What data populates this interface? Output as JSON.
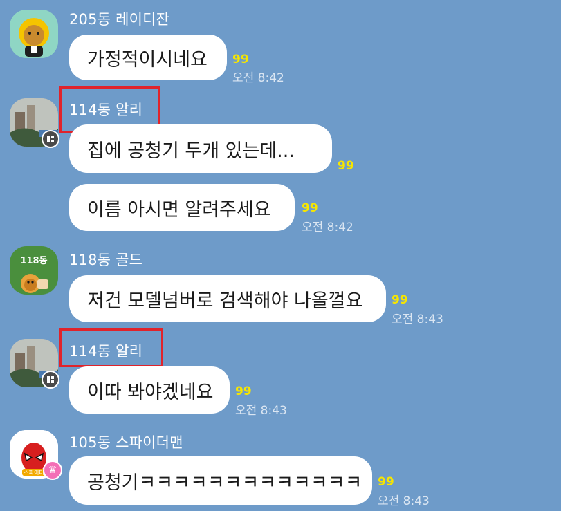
{
  "messages": [
    {
      "sender": "205동 레이디잔",
      "text": "가정적이시네요",
      "unread": "99",
      "time": "오전 8:42"
    },
    {
      "sender": "114동 알리",
      "text": "집에 공청기 두개 있는데...",
      "unread": "99",
      "time": ""
    },
    {
      "sender": "",
      "text": "이름  아시면 알려주세요",
      "unread": "99",
      "time": "오전 8:42"
    },
    {
      "sender": "118동 골드",
      "text": "저건 모델넘버로 검색해야 나올껄요",
      "unread": "99",
      "time": "오전 8:43",
      "avatar_label": "118동"
    },
    {
      "sender": "114동 알리",
      "text": "이따 봐야겠네요",
      "unread": "99",
      "time": "오전 8:43"
    },
    {
      "sender": "105동 스파이더맨",
      "text": "공청기ㅋㅋㅋㅋㅋㅋㅋㅋㅋㅋㅋㅋㅋ",
      "unread": "99",
      "time": "오전 8:43",
      "avatar_label": "스파이더"
    }
  ],
  "colors": {
    "chat_background": "#6e9bc9",
    "bubble": "#ffffff",
    "unread": "#f7e600",
    "highlight": "#e0232b"
  },
  "icons": {
    "avatar_205": "kakao-ryan-character",
    "avatar_114": "landscape-photo",
    "avatar_118": "kakao-ryan-character",
    "avatar_105": "spiderman-mask",
    "profile_badge": "grid-badge-icon",
    "crown_badge": "crown-icon"
  }
}
